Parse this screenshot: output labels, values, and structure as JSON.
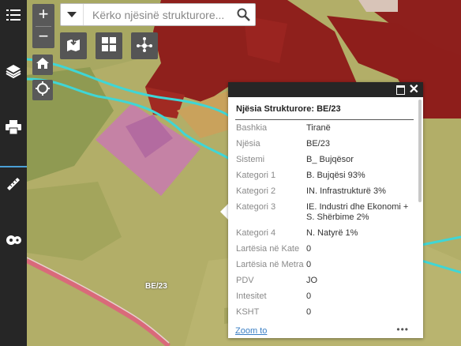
{
  "search": {
    "placeholder": "Kërko njësinë strukturore..."
  },
  "map": {
    "label": "BE/23"
  },
  "popup": {
    "title": "Njësia Strukturore: BE/23",
    "rows": [
      {
        "k": "Bashkia",
        "v": "Tiranë"
      },
      {
        "k": "Njësia",
        "v": "BE/23"
      },
      {
        "k": "Sistemi",
        "v": "B_ Bujqësor"
      },
      {
        "k": "Kategori 1",
        "v": "B. Bujqësi 93%"
      },
      {
        "k": "Kategori 2",
        "v": "IN. Infrastrukturë 3%"
      },
      {
        "k": "Kategori 3",
        "v": "IE. Industri dhe Ekonomi + S. Shërbime 2%"
      },
      {
        "k": "Kategori 4",
        "v": "N. Natyrë 1%"
      },
      {
        "k": "Lartësia në Kate",
        "v": "0"
      },
      {
        "k": "Lartësia në Metra",
        "v": "0"
      },
      {
        "k": "PDV",
        "v": "JO"
      },
      {
        "k": "Intesitet",
        "v": "0"
      },
      {
        "k": "KSHT",
        "v": "0"
      }
    ],
    "zoom_link": "Zoom to",
    "more": "•••"
  },
  "zoom": {
    "in": "+",
    "out": "−"
  },
  "icons": [
    "menu-icon",
    "layers-icon",
    "print-icon",
    "measure-icon",
    "film-icon",
    "home-icon",
    "locate-icon",
    "basemap-icon",
    "grid-icon",
    "share-icon",
    "search-icon",
    "dropdown-icon"
  ],
  "colors": {
    "sidebar": "#262626",
    "toolbar": "#595959",
    "link": "#3b7fc4"
  }
}
